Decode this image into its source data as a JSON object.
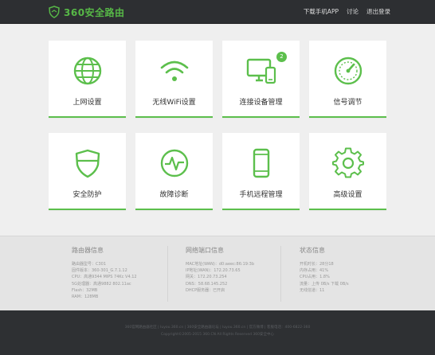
{
  "header": {
    "logo_text": "360安全路由",
    "nav": [
      "下载手机APP",
      "讨论",
      "退出登录"
    ]
  },
  "tiles": [
    {
      "label": "上网设置",
      "icon": "globe-icon"
    },
    {
      "label": "无线WiFi设置",
      "icon": "wifi-icon"
    },
    {
      "label": "连接设备管理",
      "icon": "devices-icon",
      "badge": "2"
    },
    {
      "label": "信号调节",
      "icon": "gauge-icon"
    },
    {
      "label": "安全防护",
      "icon": "shield-icon"
    },
    {
      "label": "故障诊断",
      "icon": "pulse-icon"
    },
    {
      "label": "手机远程管理",
      "icon": "phone-icon"
    },
    {
      "label": "高级设置",
      "icon": "gear-icon"
    }
  ],
  "info": {
    "router": {
      "title": "路由器信息",
      "rows": [
        "路由器型号：C301",
        "固件版本：360-301_G.7.1.12",
        "CPU：高通9344 MIPS 74Kc V4.12",
        "5G处理器：高通9882 802.11ac",
        "Flash：32MB",
        "RAM：128MB"
      ]
    },
    "wan": {
      "title": "网络端口信息",
      "rows": [
        "MAC地址(WAN)：d0:aeec:86:19:3b",
        "IP地址(WAN)：172.20.73.65",
        "网关：172.20.73.254",
        "DNS：58.68.145.252",
        "DHCP服务器：已开启"
      ]
    },
    "status": {
      "title": "状态信息",
      "rows": [
        "开机时长：28分18",
        "内存占用：41%",
        "CPU占用：1.8%",
        "流量：上传 0B/s 下载 0B/s",
        "无线信道：11"
      ]
    }
  },
  "footer": {
    "line1": "360官网路由器社区 | luyou.360.cn | 360安全路由器论坛 | luyou.360.cn | 官方微博 | 客服电话：400-6822-360",
    "line2": "Copyright©2005-2015 360.CN All Rights Reserved 360安全中心"
  },
  "colors": {
    "accent": "#5cbf4c",
    "header_bg": "#2d2f32",
    "footer_bg": "#2e3033"
  }
}
